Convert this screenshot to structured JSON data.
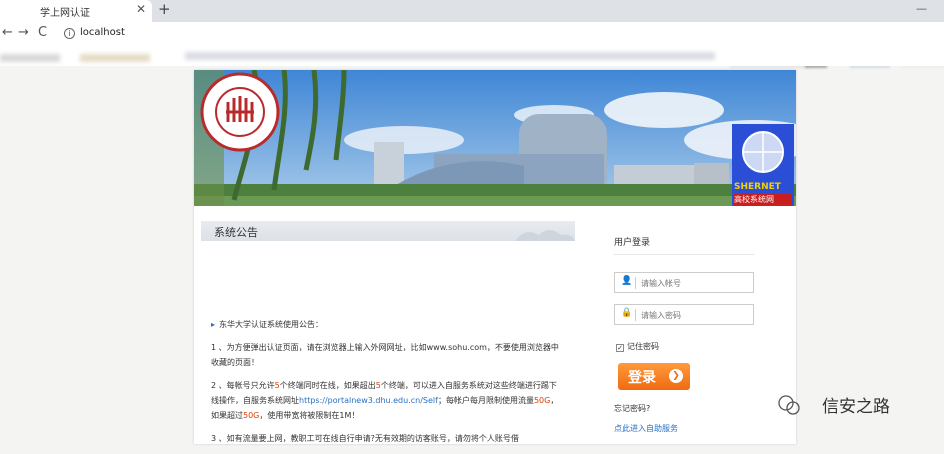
{
  "browser": {
    "tab_title": "学上网认证",
    "close_glyph": "✕",
    "new_tab_glyph": "+",
    "minimize_glyph": "—",
    "back_glyph": "←",
    "forward_glyph": "→",
    "reload_glyph": "C",
    "info_glyph": "i",
    "url": "localhost"
  },
  "notice": {
    "title": "系统公告",
    "heading": "东华大学认证系统使用公告：",
    "p1": "1 、为方便弹出认证页面，请在浏览器上输入外网网址，比如www.sohu.com，不要使用浏览器中收藏的页面！",
    "p2_a": "2 、每帐号只允许",
    "p2_b": "5",
    "p2_c": "个终端同时在线，如果超出",
    "p2_d": "5",
    "p2_e": "个终端，可以进入自服务系统对这些终端进行踢下线操作，自服务系统网址",
    "p2_link": "https://portalnew3.dhu.edu.cn/Self",
    "p2_f": "；每帐户每月限制使用流量",
    "p2_g": "50G",
    "p2_h": "，如果超过",
    "p2_i": "50G",
    "p2_j": "，使用带宽将被限制在1M！",
    "p3": "3 、如有流量要上网，教职工可在线自行申请?无有效期的访客账号，请勿将个人账号借"
  },
  "login": {
    "title": "用户登录",
    "user_placeholder": "请输入帐号",
    "pass_placeholder": "请输入密码",
    "remember_label": "记住密码",
    "remember_check": "✓",
    "button_label": "登录",
    "button_arrow": "❯",
    "forgot_label": "忘记密码?",
    "self_service_label": "点此进入自助服务"
  },
  "banner": {
    "badge_text1": "SHERNET",
    "badge_text2": "高校系统网"
  },
  "watermark": {
    "text": "信安之路"
  },
  "colors": {
    "accent_orange": "#f06a10",
    "link_blue": "#2a70c0",
    "highlight_red": "#e03a00"
  }
}
